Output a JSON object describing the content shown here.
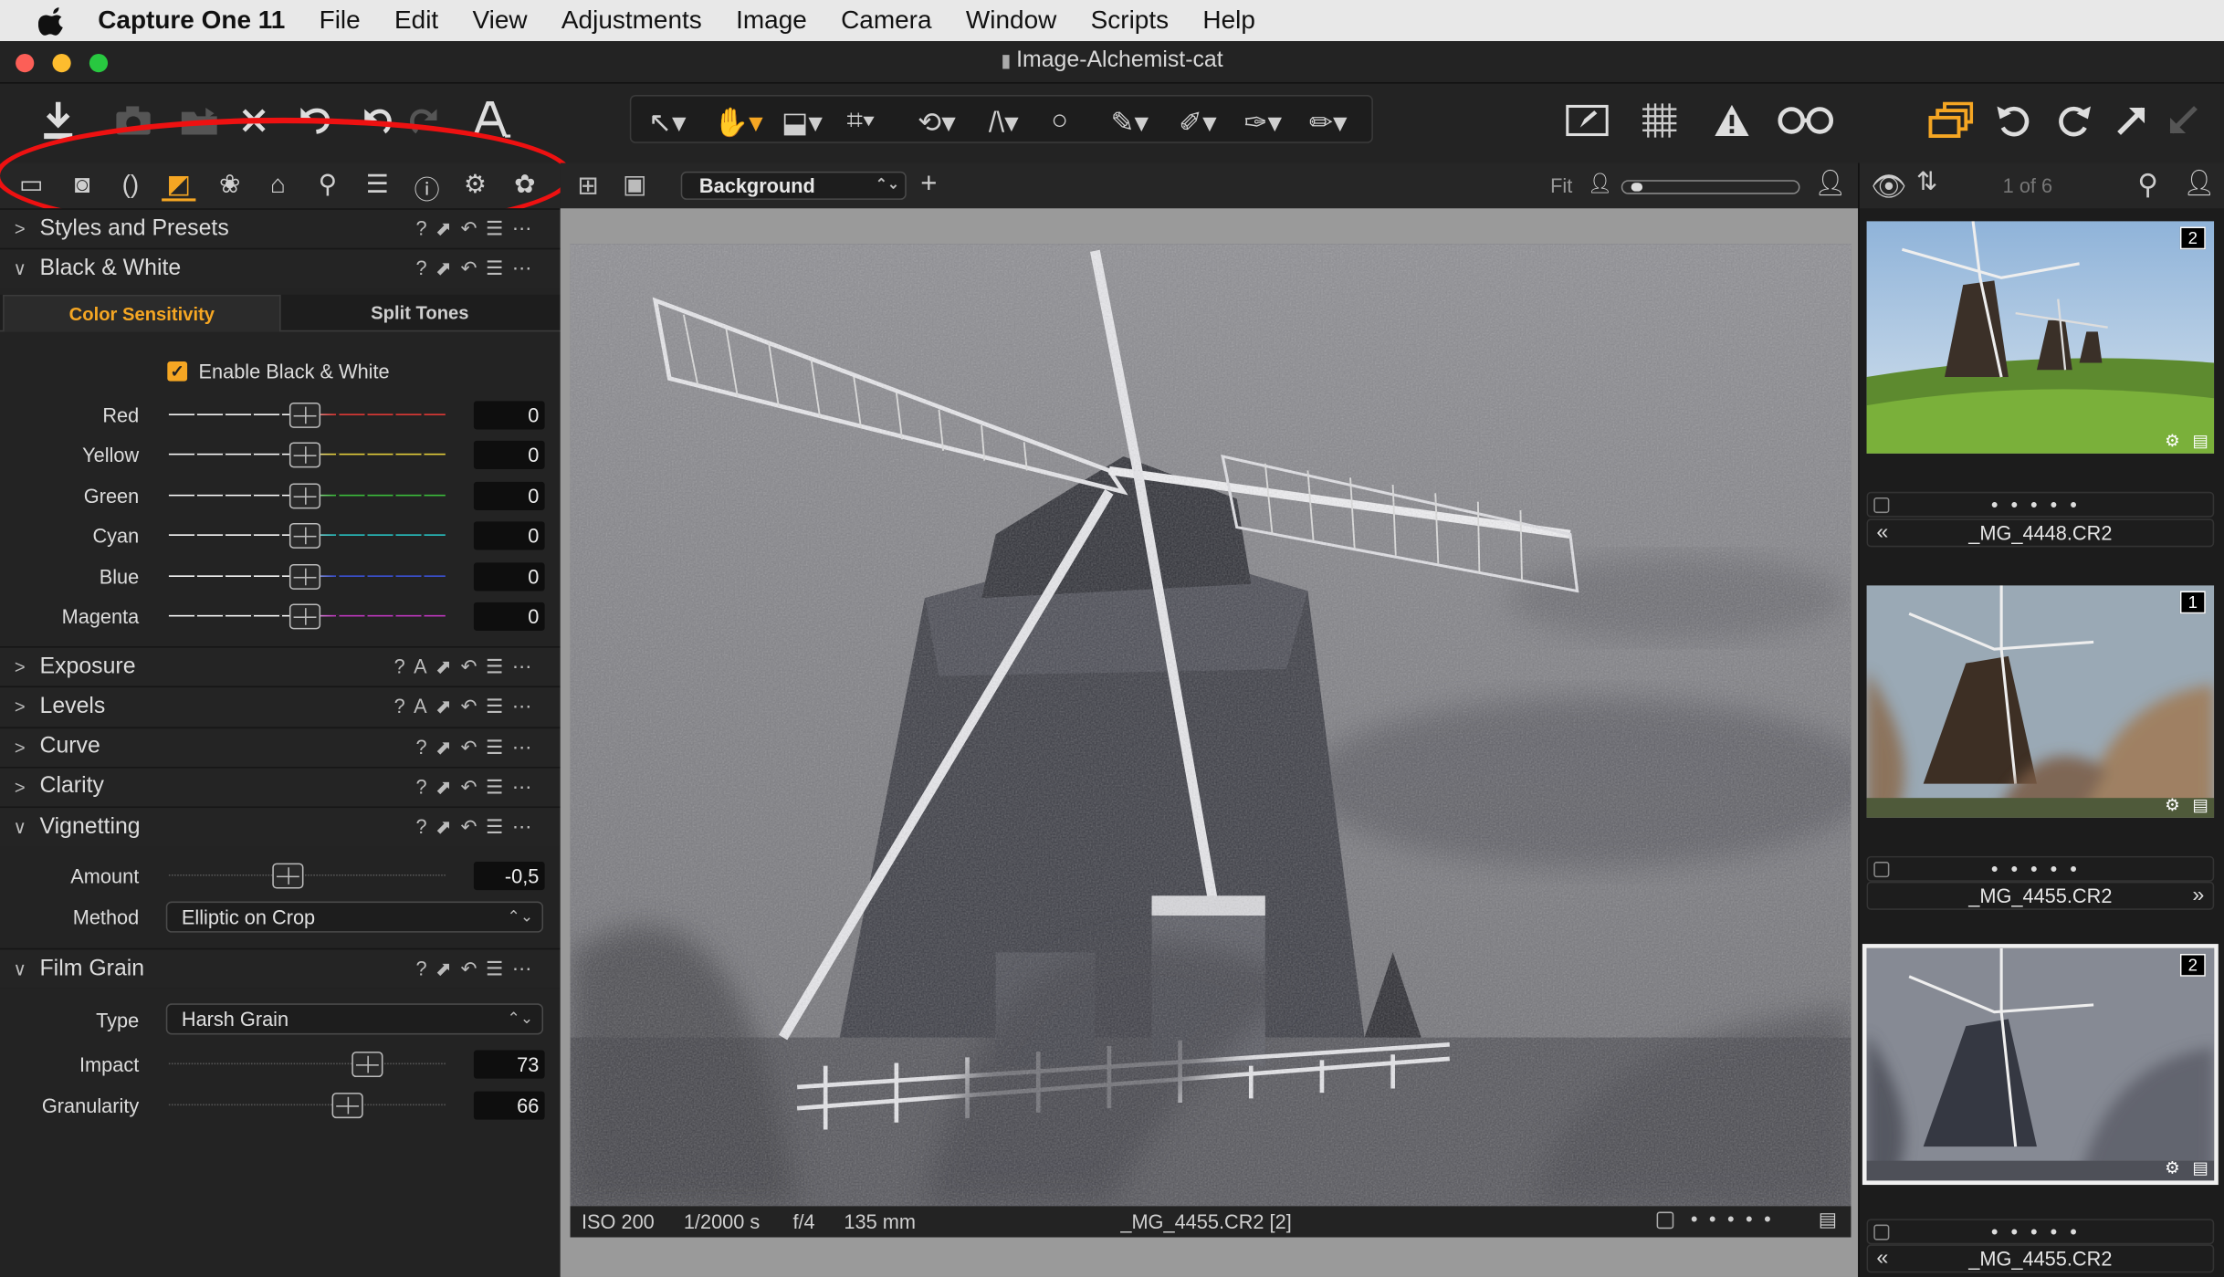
{
  "menubar": {
    "app_name": "Capture One 11",
    "items": [
      "File",
      "Edit",
      "View",
      "Adjustments",
      "Image",
      "Camera",
      "Window",
      "Scripts",
      "Help"
    ]
  },
  "window": {
    "title": "Image-Alchemist-cat"
  },
  "toolbar": {
    "left_icons": [
      "import-icon",
      "camera-icon",
      "folder-move-icon",
      "delete-icon",
      "undo-icon",
      "undo-icon",
      "redo-icon",
      "text-icon"
    ],
    "cursor_tools": [
      "pointer-icon",
      "hand-icon",
      "loupe-icon",
      "crop-icon",
      "rotate-icon",
      "keystone-icon",
      "circle-icon",
      "brush-icon",
      "picker-icon",
      "eraser-icon",
      "pen-icon"
    ],
    "right_icons": [
      "edit-mask-icon",
      "grid-icon",
      "warning-icon",
      "glasses-icon",
      "stack-icon",
      "rotate-left-icon",
      "rotate-right-icon",
      "copy-icon",
      "apply-icon"
    ]
  },
  "tool_tabs": [
    "library-icon",
    "capture-icon",
    "lens-icon",
    "color-icon",
    "exposure-icon",
    "composition-icon",
    "details-icon",
    "adjustments-icon",
    "metadata-icon",
    "settings-icon",
    "quick-icon"
  ],
  "left_panel": {
    "styles_presets": "Styles and Presets",
    "bw": {
      "title": "Black & White",
      "tabs": [
        "Color Sensitivity",
        "Split Tones"
      ],
      "enable_label": "Enable Black & White",
      "sliders": [
        {
          "label": "Red",
          "value": "0",
          "color": "#e53935"
        },
        {
          "label": "Yellow",
          "value": "0",
          "color": "#e8d23a"
        },
        {
          "label": "Green",
          "value": "0",
          "color": "#3bbf3b"
        },
        {
          "label": "Cyan",
          "value": "0",
          "color": "#27c4c4"
        },
        {
          "label": "Blue",
          "value": "0",
          "color": "#3b52d9"
        },
        {
          "label": "Magenta",
          "value": "0",
          "color": "#c238c2"
        }
      ]
    },
    "sections": [
      {
        "title": "Exposure",
        "auto": "A"
      },
      {
        "title": "Levels",
        "auto": "A"
      },
      {
        "title": "Curve",
        "auto": ""
      },
      {
        "title": "Clarity",
        "auto": ""
      }
    ],
    "vignetting": {
      "title": "Vignetting",
      "amount_label": "Amount",
      "amount_value": "-0,5",
      "method_label": "Method",
      "method_value": "Elliptic on Crop"
    },
    "film_grain": {
      "title": "Film Grain",
      "type_label": "Type",
      "type_value": "Harsh Grain",
      "impact_label": "Impact",
      "impact_value": "73",
      "granularity_label": "Granularity",
      "granularity_value": "66"
    }
  },
  "viewer": {
    "background_select": "Background",
    "fit_label": "Fit",
    "info": {
      "iso": "ISO 200",
      "shutter": "1/2000 s",
      "aperture": "f/4",
      "focal": "135 mm",
      "filename": "_MG_4455.CR2 [2]"
    }
  },
  "browser": {
    "counter": "1 of 6",
    "thumbnails": [
      {
        "name": "_MG_4448.CR2",
        "badge": "2",
        "nav": "«"
      },
      {
        "name": "_MG_4455.CR2",
        "badge": "1",
        "nav": "»"
      },
      {
        "name": "_MG_4455.CR2",
        "badge": "2",
        "nav": "«"
      }
    ]
  },
  "colors": {
    "accent": "#f5a623",
    "highlight_ellipse": "#e11111"
  }
}
